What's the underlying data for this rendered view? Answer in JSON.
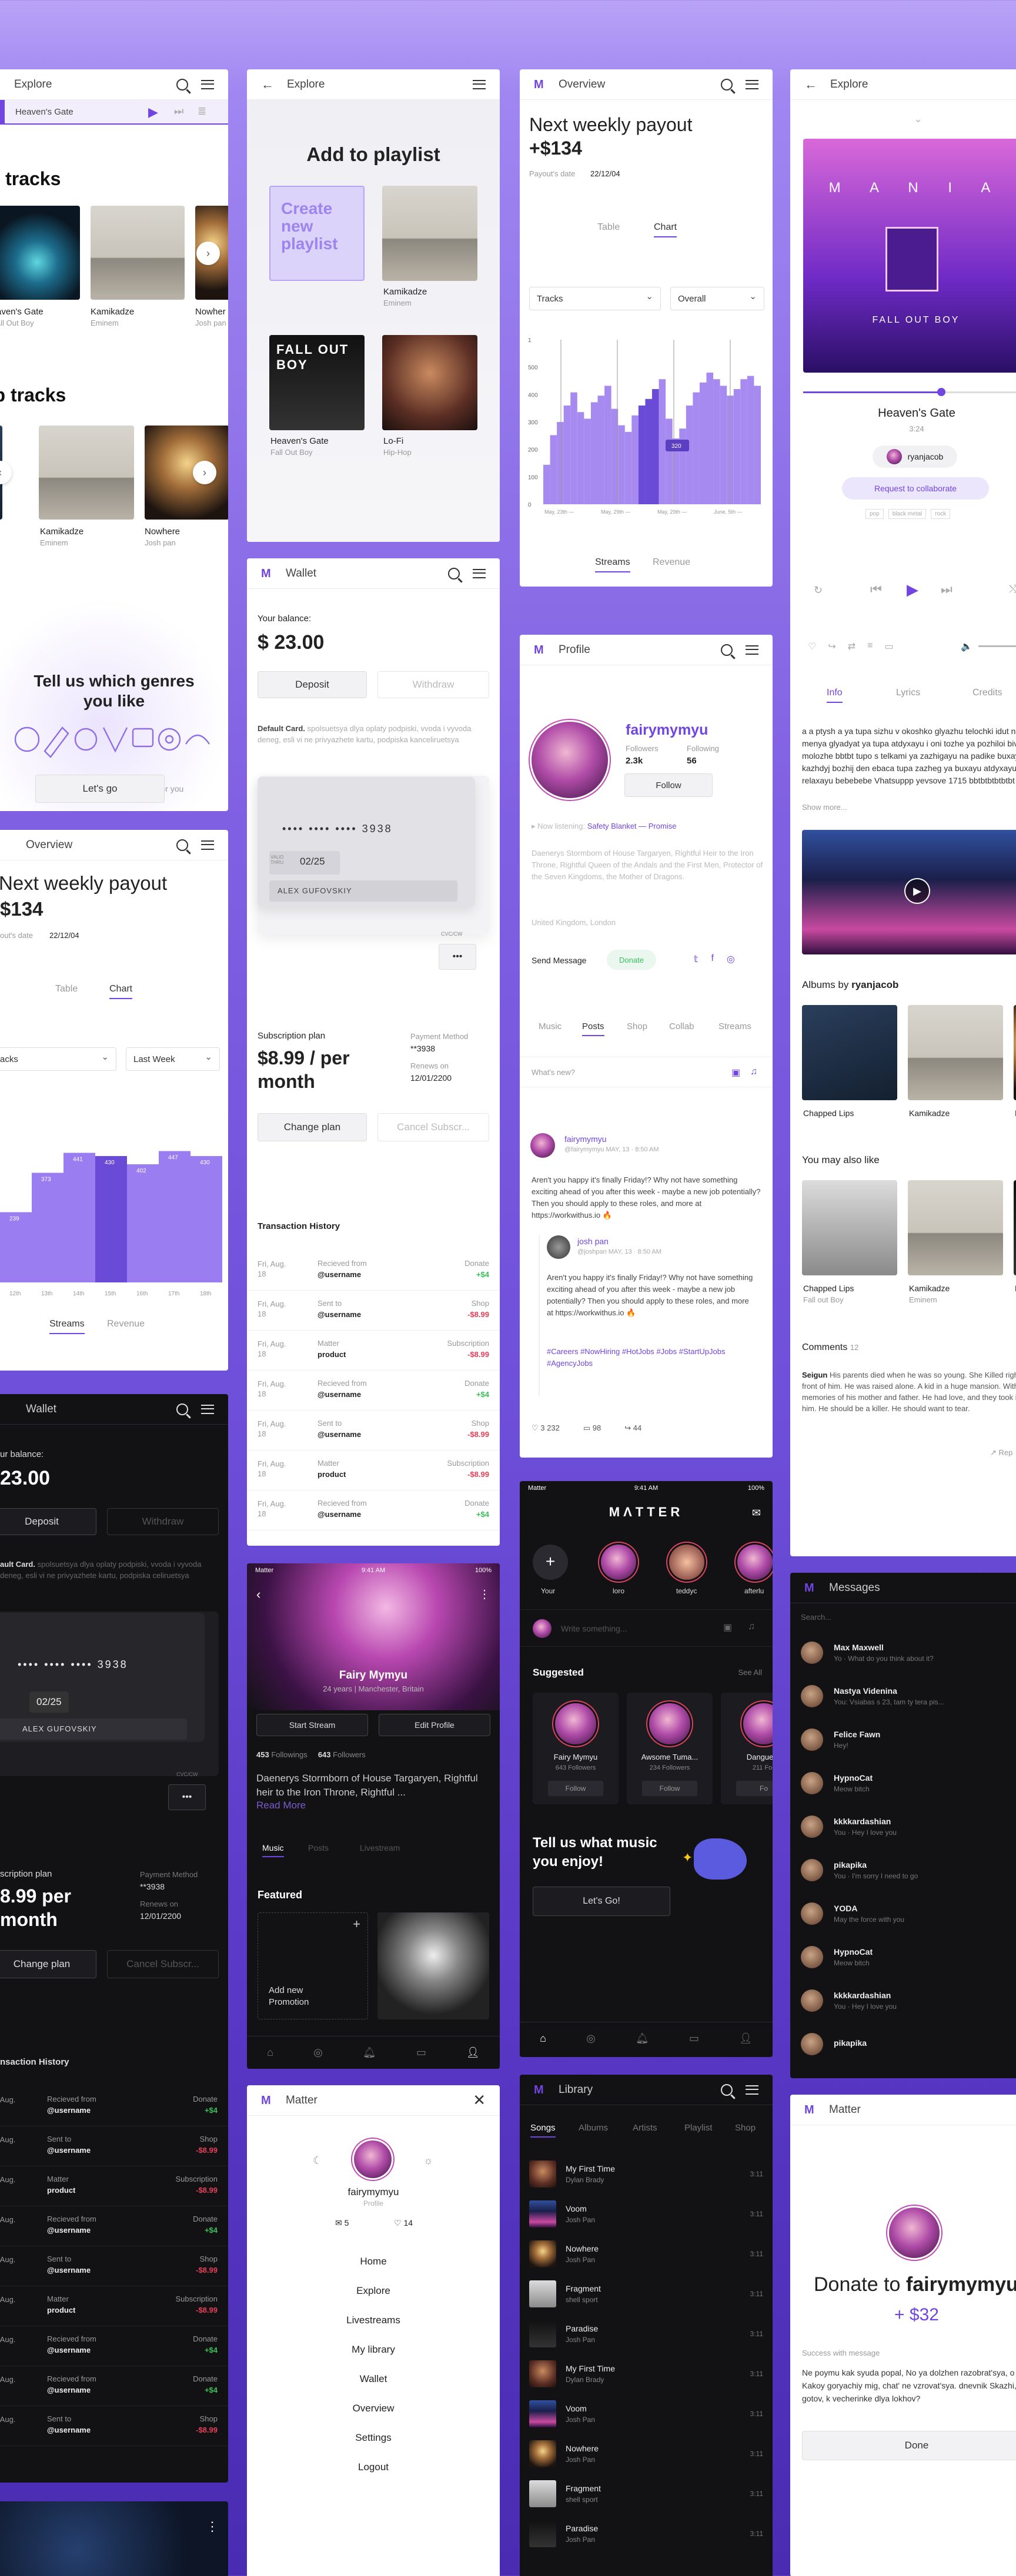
{
  "explore1": {
    "title": "Explore",
    "now_playing": "Heaven's Gate",
    "section1": "ot tracks",
    "section2": "op tracks",
    "tracks1": [
      {
        "t": "aven's Gate",
        "a": "all Out Boy"
      },
      {
        "t": "Kamikadze",
        "a": "Eminem"
      },
      {
        "t": "Nowher",
        "a": "Josh pan"
      }
    ],
    "tracks2": [
      {
        "t": "Kamikadze",
        "a": "Eminem"
      },
      {
        "t": "Nowhere",
        "a": "Josh pan"
      }
    ],
    "genres_title": "Tell us which genres you like",
    "genres_sub": "We'll create an experience just for you",
    "genres_btn": "Let's go"
  },
  "playlist": {
    "title": "Explore",
    "heading": "Add to playlist",
    "create": "Create new playlist",
    "items": [
      {
        "t": "Kamikadze",
        "a": "Eminem"
      },
      {
        "t": "Heaven's Gate",
        "a": "Fall Out Boy"
      },
      {
        "t": "Lo-Fi",
        "a": "Hip-Hop"
      }
    ]
  },
  "overview1": {
    "title": "Overview",
    "heading": "Next weekly payout",
    "amount": "+$134",
    "date_label": "Payout's date",
    "date": "22/12/04",
    "tab_table": "Table",
    "tab_chart": "Chart",
    "sel1": "Tracks",
    "sel2": "Overall",
    "yticks": [
      "1",
      "500",
      "400",
      "300",
      "200",
      "100",
      "0"
    ],
    "xticks": [
      "May, 23th —\n29th",
      "May, 29th —\nJune, 4th",
      "May, 29th —\nJune, 5th",
      "June, 5th —\n11th"
    ],
    "tooltip": "320",
    "foot1": "Streams",
    "foot2": "Revenue"
  },
  "explore2": {
    "title": "Explore",
    "track": "Heaven's Gate",
    "time": "3:24",
    "user": "ryanjacob",
    "collab": "Request to collaborate",
    "tags": [
      "pop",
      "black metal",
      "rock"
    ],
    "tabs": [
      "Info",
      "Lyrics",
      "Credits"
    ],
    "info": "a a ptysh a ya tupa sizhu v okoshko glyazhu telochki idut na menya glyadyat ya tupa atdyxayu i oni tozhe ya pozhiloi bivis ya molozhe bbtbt tupo s telkami ya zazhigayu na padike buxayu kazhdyj bozhij den ebaca tupa zazheg ya buxayu atdyxayu relaxayu bebebebe Vhatsuppp yevsove 1715 bbtbtbtbtbtbt tupe",
    "more": "Show more...",
    "albums_by": "Albums by",
    "albums_user": "ryanjacob",
    "albums": [
      {
        "t": "Chapped Lips",
        "a": ""
      },
      {
        "t": "Kamikadze",
        "a": ""
      },
      {
        "t": "N",
        "a": ""
      }
    ],
    "like_title": "You may also like",
    "like": [
      {
        "t": "Chapped Lips",
        "a": "Fall out Boy"
      },
      {
        "t": "Kamikadze",
        "a": "Eminem"
      },
      {
        "t": "N",
        "a": ""
      }
    ],
    "comments": "Comments",
    "comments_count": "12",
    "comment_user": "Seigun",
    "comment": "His parents died when he was so young. She Killed right in front of him. He was raised alone. A kid in a huge mansion. With his memories of his mother and father. He had love, and they took it from him. He should be a killer. He should want to tear.",
    "reply": "Rep"
  },
  "wallet1": {
    "title": "Wallet",
    "balance_label": "Your balance:",
    "balance": "$ 23.00",
    "deposit": "Deposit",
    "withdraw": "Withdraw",
    "default_card": "Default Card.",
    "card_text": "spolsuetsya dlya oplaty podpiski, vvoda i vyvoda deneg, esli vi ne privyazhete kartu, podpiska kanceliruetsya",
    "card_num": "••••  ••••  ••••  3938",
    "valid": "02/25",
    "valid_label": "VALID THRU",
    "holder": "ALEX GUFOVSKIY",
    "cvc_label": "CVC/CW",
    "cvc": "•••",
    "sub_label": "Subscription plan",
    "sub_price": "$8.99 / per month",
    "pm_label": "Payment Method",
    "pm": "**3938",
    "renew_label": "Renews on",
    "renew": "12/01/2200",
    "change": "Change plan",
    "cancel": "Cancel Subscr...",
    "history": "Transaction History",
    "tx": [
      {
        "d": "Fri, Aug. 18",
        "l": "Recieved from",
        "n": "@username",
        "k": "Donate",
        "v": "+$4",
        "c": "grn"
      },
      {
        "d": "Fri, Aug. 18",
        "l": "Sent to",
        "n": "@username",
        "k": "Shop",
        "v": "-$8.99",
        "c": "red"
      },
      {
        "d": "Fri, Aug. 18",
        "l": "Matter",
        "n": "product",
        "k": "Subscription",
        "v": "-$8.99",
        "c": "red"
      },
      {
        "d": "Fri, Aug. 18",
        "l": "Recieved from",
        "n": "@username",
        "k": "Donate",
        "v": "+$4",
        "c": "grn"
      },
      {
        "d": "Fri, Aug. 18",
        "l": "Sent to",
        "n": "@username",
        "k": "Shop",
        "v": "-$8.99",
        "c": "red"
      },
      {
        "d": "Fri, Aug. 18",
        "l": "Matter",
        "n": "product",
        "k": "Subscription",
        "v": "-$8.99",
        "c": "red"
      },
      {
        "d": "Fri, Aug. 18",
        "l": "Recieved from",
        "n": "@username",
        "k": "Donate",
        "v": "+$4",
        "c": "grn"
      }
    ]
  },
  "profile1": {
    "title": "Profile",
    "name": "fairymymyu",
    "followers_label": "Followers",
    "followers": "2.3k",
    "following_label": "Following",
    "following": "56",
    "follow": "Follow",
    "listening": "Now listening:",
    "song": "Safety Blanket — Promise",
    "bio": "Daenerys Stormborn of House Targaryen, Rightful Heir to the Iron Throne, Rightful Queen of the Andals and the First Men, Protector of the Seven Kingdoms, the Mother of Dragons.",
    "loc": "United Kingdom, London",
    "send": "Send Message",
    "donate": "Donate",
    "tabs": [
      "Music",
      "Posts",
      "Shop",
      "Collab",
      "Streams"
    ],
    "whats_new": "What's new?",
    "post_user": "fairymymyu",
    "post_handle": "@fairymymyu",
    "post_time": "MAY, 13 · 8:50 AM",
    "post_text": "Aren't you happy it's finally Friday!? Why not have something exciting ahead of you after this week - maybe a new job potentially? Then you should apply to these roles, and more at https://workwithus.io 🔥",
    "sub_user": "josh pan",
    "sub_handle": "@joshpan",
    "sub_time": "MAY, 13 · 8:50 AM",
    "sub_text": "Aren't you happy it's finally Friday!? Why not have something exciting ahead of you after this week - maybe a new job potentially? Then you should apply to these roles, and more at https://workwithus.io 🔥",
    "tags": "#Careers #NowHiring #HotJobs #Jobs #StartUpJobs #AgencyJobs",
    "likes": "3 232",
    "comments": "98",
    "shares": "44"
  },
  "overview2": {
    "title": "Overview",
    "heading": "Next weekly payout",
    "amount": "$134",
    "date_label": "out's date",
    "date": "22/12/04",
    "tab_table": "Table",
    "tab_chart": "Chart",
    "sel1": "racks",
    "sel2": "Last Week",
    "days": [
      "12th",
      "13th",
      "14th",
      "15th",
      "16th",
      "17th",
      "18th"
    ],
    "foot1": "Streams",
    "foot2": "Revenue"
  },
  "wallet2": {
    "title": "Wallet",
    "balance_label": "ur balance:",
    "balance": "23.00",
    "deposit": "Deposit",
    "withdraw": "Withdraw",
    "default_card": "ault Card.",
    "card_text": "spolsuetsya dlya oplaty podpiski, vvoda i vyvoda deneg, esli vi ne privyazhete kartu, podpiska celiruetsya",
    "card_num": "••••  ••••  ••••  3938",
    "valid": "02/25",
    "holder": "ALEX GUFOVSKIY",
    "cvc": "•••",
    "cvc_label": "CVC/CW",
    "sub_label": "scription plan",
    "sub_price": "8.99 per month",
    "pm_label": "Payment Method",
    "pm": "**3938",
    "renew_label": "Renews on",
    "renew": "12/01/2200",
    "change": "Change plan",
    "cancel": "Cancel Subscr...",
    "history": "nsaction History"
  },
  "mprofile": {
    "status_left": "Matter",
    "status_time": "9:41 AM",
    "status_right": "100%",
    "name": "Fairy Mymyu",
    "sub": "24 years | Manchester, Britain",
    "start": "Start Stream",
    "edit": "Edit Profile",
    "followings": "453",
    "followings_label": "Followings",
    "followers": "643",
    "followers_label": "Followers",
    "bio": "Daenerys Stormborn of House Targaryen, Rightful heir to the Iron Throne, Rightful ...",
    "more": "Read More",
    "tabs": [
      "Music",
      "Posts",
      "Livestream"
    ],
    "featured": "Featured",
    "add": "Add new Promotion"
  },
  "feed": {
    "status_left": "Matter",
    "status_time": "9:41 AM",
    "status_right": "100%",
    "logo": "MΛTTER",
    "stories": [
      "Your",
      "loro",
      "teddyc",
      "afterlu"
    ],
    "write": "Write something...",
    "suggested": "Suggested",
    "see_all": "See All",
    "cards": [
      {
        "n": "Fairy Mymyu",
        "f": "643 Followers",
        "b": "Follow"
      },
      {
        "n": "Awsome Tuma...",
        "f": "234 Followers",
        "b": "Follow"
      },
      {
        "n": "Dangue D",
        "f": "211 Foll",
        "b": "Fo"
      }
    ],
    "promo_title": "Tell us what music you enjoy!",
    "promo_btn": "Let's Go!"
  },
  "messages": {
    "title": "Messages",
    "search": "Search...",
    "items": [
      {
        "n": "Max Maxwell",
        "p": "Yo · What do you think about it?"
      },
      {
        "n": "Nastya Videnina",
        "p": "You: Vsiabas s 23, tam ty tera pis..."
      },
      {
        "n": "Felice Fawn",
        "p": "Hey!"
      },
      {
        "n": "HypnoCat",
        "p": "Meow bitch"
      },
      {
        "n": "kkkkardashian",
        "p": "You · Hey I love you"
      },
      {
        "n": "pikapika",
        "p": "You · I'm sorry I need to go"
      },
      {
        "n": "YODA",
        "p": "May the force with you"
      },
      {
        "n": "HypnoCat",
        "p": "Meow bitch"
      },
      {
        "n": "kkkkardashian",
        "p": "You · Hey I love you"
      },
      {
        "n": "pikapika",
        "p": ""
      }
    ]
  },
  "menu": {
    "title": "Matter",
    "name": "fairymymyu",
    "role": "Profile",
    "msgs": "5",
    "likes": "14",
    "items": [
      "Home",
      "Explore",
      "Livestreams",
      "My library",
      "Wallet",
      "Overview",
      "Settings",
      "Logout"
    ]
  },
  "library": {
    "title": "Library",
    "tabs": [
      "Songs",
      "Albums",
      "Artists",
      "Playlist",
      "Shop"
    ],
    "songs": [
      {
        "n": "My First Time",
        "a": "Dylan Brady",
        "d": "3:11"
      },
      {
        "n": "Voom",
        "a": "Josh Pan",
        "d": "3:11"
      },
      {
        "n": "Nowhere",
        "a": "Josh Pan",
        "d": "3:11"
      },
      {
        "n": "Fragment",
        "a": "shell sport",
        "d": "3:11"
      },
      {
        "n": "Paradise",
        "a": "Josh Pan",
        "d": "3:11"
      },
      {
        "n": "My First Time",
        "a": "Dylan Brady",
        "d": "3:11"
      },
      {
        "n": "Voom",
        "a": "Josh Pan",
        "d": "3:11"
      },
      {
        "n": "Nowhere",
        "a": "Josh Pan",
        "d": "3:11"
      },
      {
        "n": "Fragment",
        "a": "shell sport",
        "d": "3:11"
      },
      {
        "n": "Paradise",
        "a": "Josh Pan",
        "d": "3:11"
      }
    ]
  },
  "donate": {
    "title": "Matter",
    "text": "Donate to",
    "name": "fairymymyu",
    "amount": "+ $32",
    "success": "Success with message",
    "msg": "Ne poymu kak syuda popal, No ya dolzhen razobrat'sya, o da!  Kakoy goryachiy mig, chat' ne vzrovat'sya. dnevnik Skazhi, a ty gotov, k vecherinke dlya lokhov?",
    "done": "Done"
  },
  "colors": {
    "accent": "#7045e0",
    "green": "#3cbf5a",
    "red": "#e4405a"
  }
}
